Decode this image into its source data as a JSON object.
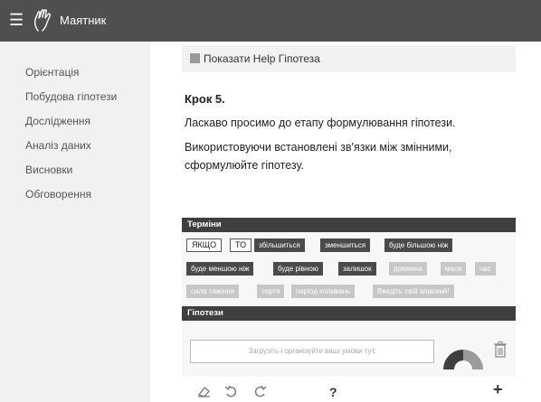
{
  "header": {
    "menu_icon": "hamburger-icon",
    "logo_icon": "hand-icon",
    "title": "Маятник"
  },
  "sidebar": {
    "items": [
      {
        "label": "Орієнтація"
      },
      {
        "label": "Побудова гіпотези"
      },
      {
        "label": "Дослідження"
      },
      {
        "label": "Аналіз даних"
      },
      {
        "label": "Висновки"
      },
      {
        "label": "Обговорення"
      }
    ]
  },
  "help": {
    "label": "Показати Help Гіпотеза"
  },
  "step": {
    "title": "Крок 5.",
    "para1": "Ласкаво просимо до етапу формулювання гіпотези.",
    "para2_line1": "Використовуючи встановлені зв'язки між змінними,",
    "para2_line2": "сформулюйте гіпотезу."
  },
  "terms": {
    "header": "Терміни",
    "tags": [
      {
        "label": "ЯКЩО"
      },
      {
        "label": "ТО"
      },
      {
        "label": "збільшиться"
      },
      {
        "label": "зменшиться"
      },
      {
        "label": "буде більшою ніж"
      },
      {
        "label": "буде меншою ніж"
      },
      {
        "label": "буде рівною"
      },
      {
        "label": "залишок"
      },
      {
        "label": "довжина"
      },
      {
        "label": "маса"
      },
      {
        "label": "час"
      },
      {
        "label": "сила тяжіння"
      },
      {
        "label": "тертя"
      },
      {
        "label": "період коливань"
      },
      {
        "label": "Введіть свій власний!"
      }
    ]
  },
  "hypotheses": {
    "header": "Гіпотези",
    "placeholder": "Загрузіть і організуйте ваші умови тут.",
    "help_glyph": "?",
    "add_glyph": "+"
  },
  "colors": {
    "topbar": "#4f4f4f",
    "sidebar": "#f1f1f1",
    "panel_header": "#3f3f3f",
    "tag_dark": "#4a4a4a",
    "tag_light": "#c7c7c7"
  }
}
